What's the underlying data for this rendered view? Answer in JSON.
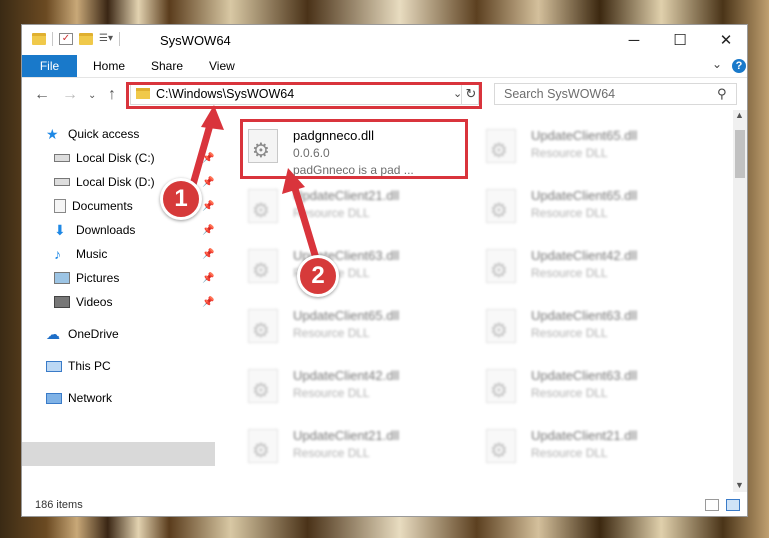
{
  "window": {
    "title": "SysWOW64",
    "minimize": "─",
    "maximize": "☐",
    "close": "✕"
  },
  "ribbon": {
    "tabs": [
      "File",
      "Home",
      "Share",
      "View"
    ],
    "help": "?"
  },
  "navigation": {
    "address": "C:\\Windows\\SysWOW64",
    "search_placeholder": "Search SysWOW64"
  },
  "sidebar": {
    "items": [
      {
        "label": "Quick access",
        "icon": "star-icon"
      },
      {
        "label": "Local Disk (C:)",
        "icon": "drive-icon",
        "pinned": true
      },
      {
        "label": "Local Disk (D:)",
        "icon": "drive-icon",
        "pinned": true
      },
      {
        "label": "Documents",
        "icon": "documents-icon",
        "pinned": true
      },
      {
        "label": "Downloads",
        "icon": "download-arrow-icon",
        "pinned": true
      },
      {
        "label": "Music",
        "icon": "music-note-icon",
        "pinned": true
      },
      {
        "label": "Pictures",
        "icon": "pictures-icon",
        "pinned": true
      },
      {
        "label": "Videos",
        "icon": "videos-icon",
        "pinned": true
      },
      {
        "label": "OneDrive",
        "icon": "cloud-icon"
      },
      {
        "label": "This PC",
        "icon": "monitor-icon",
        "selected": true
      },
      {
        "label": "Network",
        "icon": "network-icon"
      }
    ]
  },
  "files": [
    {
      "name": "padgnneco.dll",
      "line2": "0.0.6.0",
      "line3": "padGnneco is a pad ...",
      "highlighted": true
    },
    {
      "name": "UpdateClient65.dll",
      "line2": "Resource DLL"
    },
    {
      "name": "UpdateClient21.dll",
      "line2": "Resource DLL"
    },
    {
      "name": "UpdateClient65.dll",
      "line2": "Resource DLL"
    },
    {
      "name": "UpdateClient63.dll",
      "line2": "Resource DLL"
    },
    {
      "name": "UpdateClient42.dll",
      "line2": "Resource DLL"
    },
    {
      "name": "UpdateClient65.dll",
      "line2": "Resource DLL"
    },
    {
      "name": "UpdateClient63.dll",
      "line2": "Resource DLL"
    },
    {
      "name": "UpdateClient42.dll",
      "line2": "Resource DLL"
    },
    {
      "name": "UpdateClient63.dll",
      "line2": "Resource DLL"
    },
    {
      "name": "UpdateClient21.dll",
      "line2": "Resource DLL"
    },
    {
      "name": "UpdateClient21.dll",
      "line2": "Resource DLL"
    }
  ],
  "status": {
    "item_count": "186 items"
  },
  "annotations": {
    "badge1": "1",
    "badge2": "2",
    "color": "#d9343c"
  },
  "colors": {
    "accent": "#1979ca",
    "folder": "#f0c94a",
    "selected_bg": "#d9d9d9"
  }
}
